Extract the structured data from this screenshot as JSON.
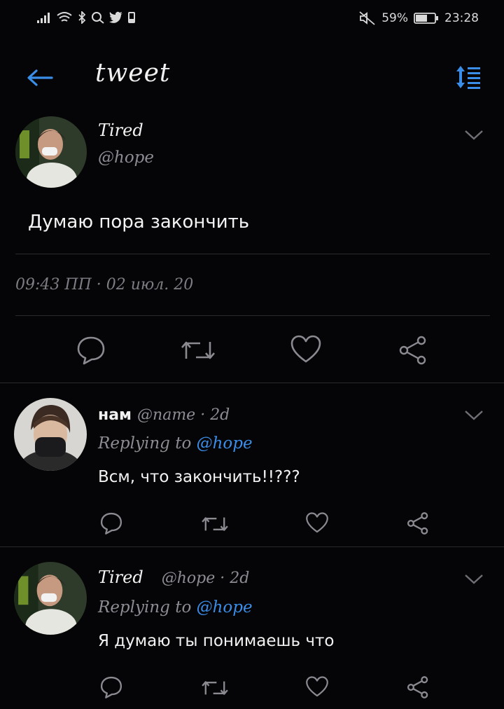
{
  "status_bar": {
    "battery": "59%",
    "time": "23:28"
  },
  "header": {
    "title": "tweet"
  },
  "main_tweet": {
    "name": "Tired",
    "handle": "@hope",
    "text": "Думаю пора закончить",
    "timestamp": "09:43 ПП · 02 июл. 20"
  },
  "replies": [
    {
      "name": "нам",
      "handle": "@name",
      "age": "· 2d",
      "replying_prefix": "Replying to",
      "replying_to": "@hope",
      "text": "Всм, что закончить!!???"
    },
    {
      "name": "Tired",
      "handle": "@hope",
      "age": "· 2d",
      "replying_prefix": "Replying to",
      "replying_to": "@hope",
      "text": "Я думаю ты понимаешь что"
    }
  ],
  "icons": {
    "back": "arrow-left-icon",
    "sort": "sort-icon",
    "reply": "comment-icon",
    "retweet": "retweet-icon",
    "like": "heart-icon",
    "share": "share-icon"
  },
  "colors": {
    "background": "#050507",
    "accent": "#3b8ee8",
    "muted": "#8c8c92"
  }
}
